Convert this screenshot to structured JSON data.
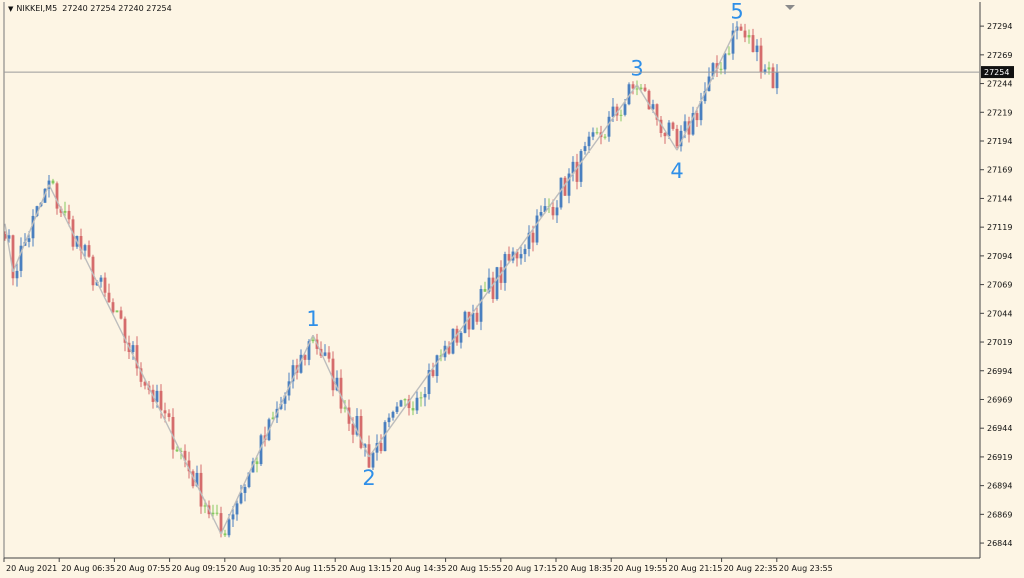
{
  "header": {
    "symbol": "NIKKEI,M5",
    "ohlc": "27240 27254 27240 27254"
  },
  "colors": {
    "background": "#fdf5e4",
    "bull": "#4a7fbf",
    "bear": "#d56c6c",
    "doji": "#86c960",
    "wave_line": "#bdbdbd",
    "price_line": "#9a9a9a",
    "wave_label": "#2f8fe8",
    "price_tag_bg": "#111111",
    "price_tag_text": "#ffffff"
  },
  "icons": {
    "symbol_menu": "triangle-down-icon",
    "shift_marker": "triangle-down-icon"
  },
  "chart_data": {
    "type": "candlestick",
    "title": "NIKKEI,M5",
    "symbol": "NIKKEI",
    "timeframe": "M5",
    "ylim": [
      26831,
      27315
    ],
    "y_ticks": [
      26844,
      26869,
      26894,
      26919,
      26944,
      26969,
      26994,
      27019,
      27044,
      27069,
      27094,
      27119,
      27144,
      27169,
      27194,
      27219,
      27244,
      27269,
      27294
    ],
    "x_ticks": [
      "20 Aug 2021",
      "20 Aug 06:35",
      "20 Aug 07:55",
      "20 Aug 09:15",
      "20 Aug 10:35",
      "20 Aug 11:55",
      "20 Aug 13:15",
      "20 Aug 14:35",
      "20 Aug 15:55",
      "20 Aug 17:15",
      "20 Aug 18:35",
      "20 Aug 19:55",
      "20 Aug 21:15",
      "20 Aug 22:35",
      "20 Aug 23:55"
    ],
    "current_price": 27254,
    "candle_count": 194,
    "zigzag": [
      {
        "bar": 0,
        "price": 27122
      },
      {
        "bar": 2,
        "price": 27080
      },
      {
        "bar": 11,
        "price": 27156
      },
      {
        "bar": 54,
        "price": 26852
      },
      {
        "bar": 77,
        "price": 27025
      },
      {
        "bar": 91,
        "price": 26919
      },
      {
        "bar": 158,
        "price": 27243
      },
      {
        "bar": 168,
        "price": 27186
      },
      {
        "bar": 183,
        "price": 27293
      }
    ],
    "wave_labels": [
      {
        "label": "1",
        "bar": 77,
        "price": 27025,
        "position": "above"
      },
      {
        "label": "2",
        "bar": 91,
        "price": 26919,
        "position": "below"
      },
      {
        "label": "3",
        "bar": 158,
        "price": 27243,
        "position": "above"
      },
      {
        "label": "4",
        "bar": 168,
        "price": 27186,
        "position": "below"
      },
      {
        "label": "5",
        "bar": 183,
        "price": 27293,
        "position": "above"
      }
    ],
    "legend": "none",
    "grid": false
  }
}
